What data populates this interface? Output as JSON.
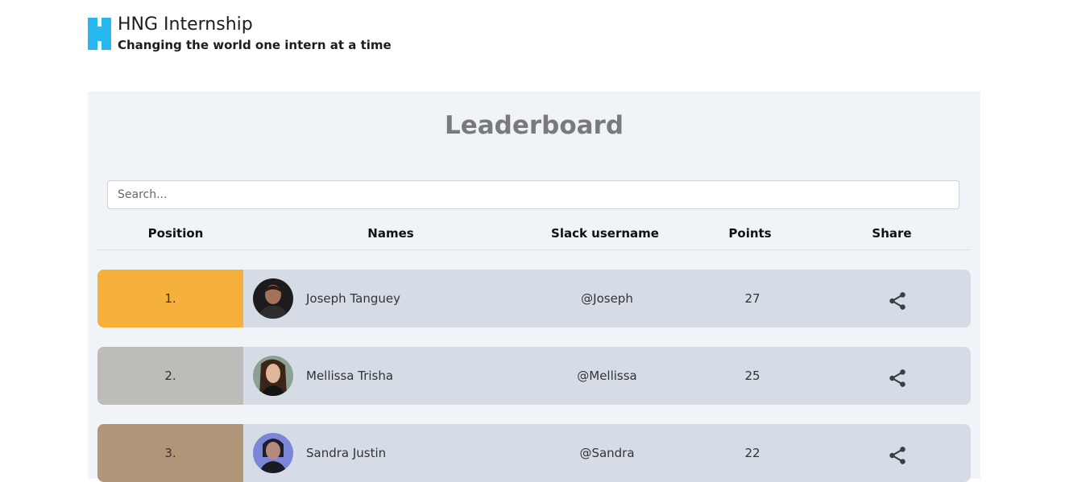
{
  "header": {
    "title": "HNG Internship",
    "subtitle": "Changing the world one intern at a time"
  },
  "board": {
    "title": "Leaderboard",
    "search": {
      "placeholder": "Search...",
      "value": ""
    },
    "columns": [
      "Position",
      "Names",
      "Slack username",
      "Points",
      "Share"
    ],
    "rows": [
      {
        "position": "1.",
        "name": "Joseph Tanguey",
        "slack": "@Joseph",
        "points": "27",
        "rank_color": "#f5b13b"
      },
      {
        "position": "2.",
        "name": "Mellissa Trisha",
        "slack": "@Mellissa",
        "points": "25",
        "rank_color": "#bdbcb9"
      },
      {
        "position": "3.",
        "name": "Sandra Justin",
        "slack": "@Sandra",
        "points": "22",
        "rank_color": "#b09578"
      }
    ]
  },
  "colors": {
    "accent": "#27b8ef",
    "board_bg": "#f0f3f7",
    "row_bg": "#d6dce6"
  },
  "icons": {
    "share": "share-icon"
  }
}
